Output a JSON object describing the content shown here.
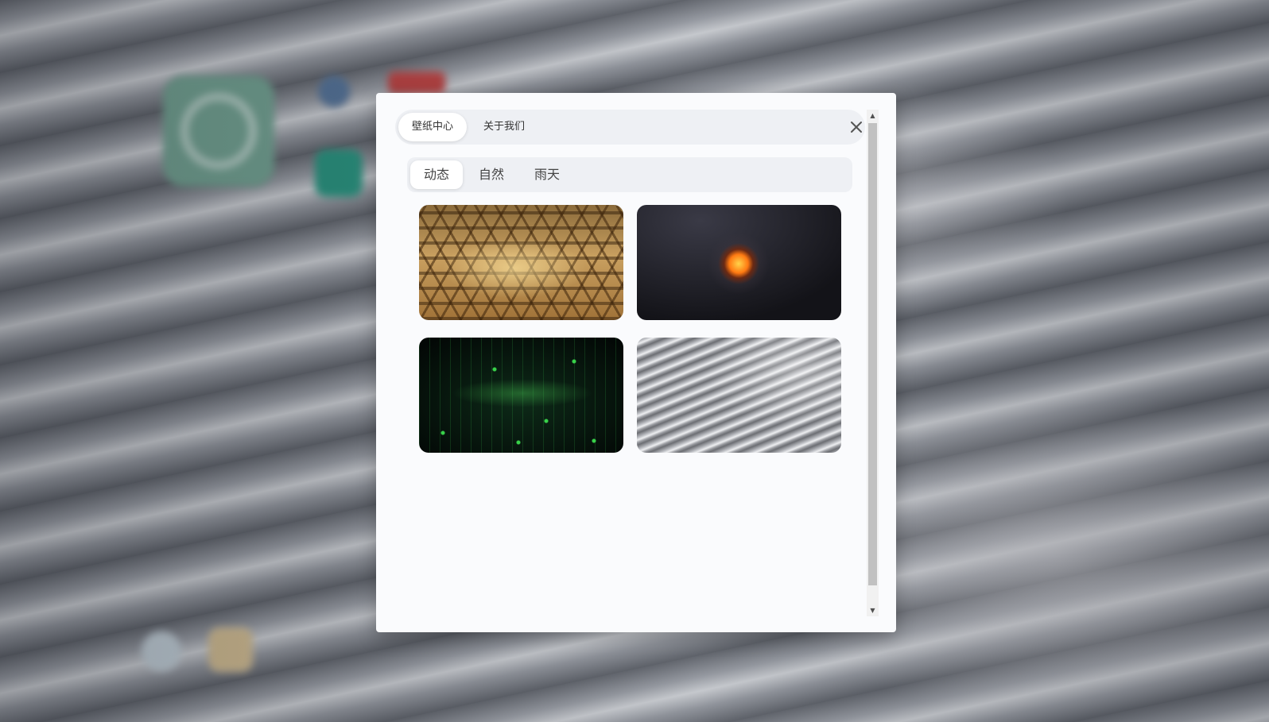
{
  "dialog": {
    "tabs": [
      {
        "label": "壁纸中心",
        "active": true
      },
      {
        "label": "关于我们",
        "active": false
      }
    ],
    "close_icon": "close-icon"
  },
  "categories": [
    {
      "label": "动态",
      "active": true
    },
    {
      "label": "自然",
      "active": false
    },
    {
      "label": "雨天",
      "active": false
    }
  ],
  "wallpapers": [
    {
      "theme": "golden hexagon grid"
    },
    {
      "theme": "fiery explosion on dark background"
    },
    {
      "theme": "green digital particles"
    },
    {
      "theme": "silver flowing waves"
    }
  ],
  "scrollbar": {
    "up_icon": "arrow-up-icon",
    "down_icon": "arrow-down-icon"
  }
}
